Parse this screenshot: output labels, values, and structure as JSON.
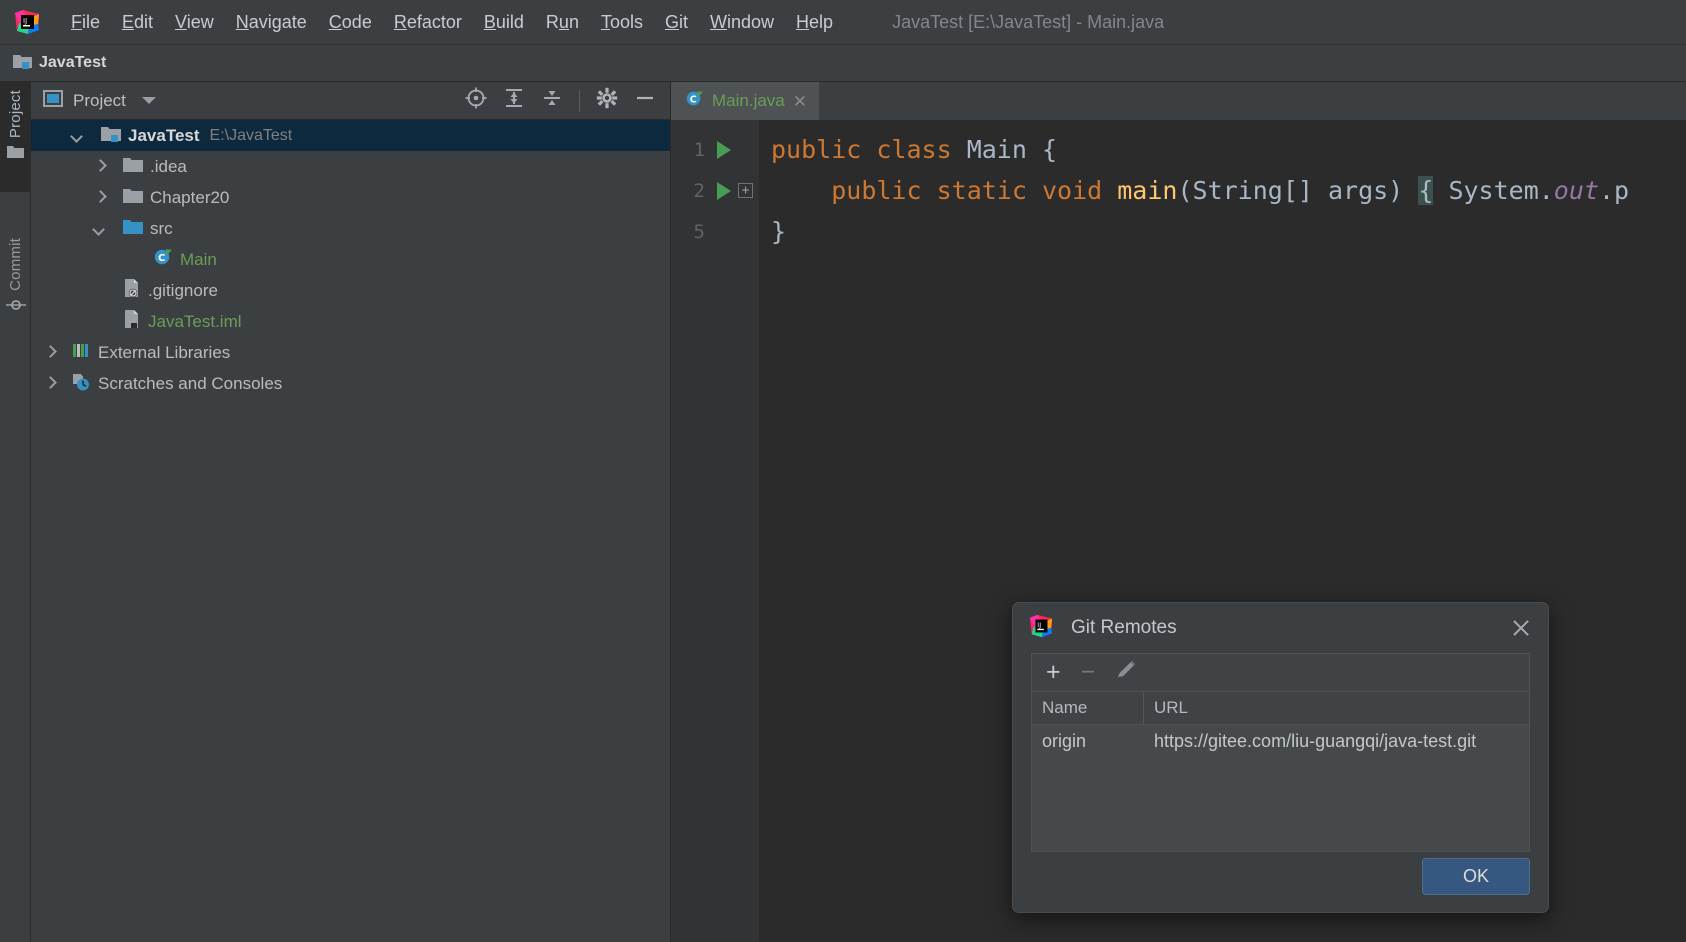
{
  "app": {
    "window_title": "JavaTest [E:\\JavaTest] - Main.java",
    "logo_icon": "intellij-idea-logo"
  },
  "menubar": {
    "items": [
      {
        "label": "File",
        "mnemonic": "F"
      },
      {
        "label": "Edit",
        "mnemonic": "E"
      },
      {
        "label": "View",
        "mnemonic": "V"
      },
      {
        "label": "Navigate",
        "mnemonic": "N"
      },
      {
        "label": "Code",
        "mnemonic": "C"
      },
      {
        "label": "Refactor",
        "mnemonic": "R"
      },
      {
        "label": "Build",
        "mnemonic": "B"
      },
      {
        "label": "Run",
        "mnemonic": "u"
      },
      {
        "label": "Tools",
        "mnemonic": "T"
      },
      {
        "label": "Git",
        "mnemonic": "G"
      },
      {
        "label": "Window",
        "mnemonic": "W"
      },
      {
        "label": "Help",
        "mnemonic": "H"
      }
    ]
  },
  "navbar": {
    "crumb_label": "JavaTest",
    "crumb_icon": "project-folder-icon"
  },
  "tool_stripe": {
    "project_label": "Project",
    "project_icon": "folder-icon",
    "commit_label": "Commit",
    "commit_icon": "commit-icon"
  },
  "project_panel": {
    "title": "Project",
    "title_icon": "project-view-icon",
    "dropdown_icon": "chevron-down-icon",
    "actions": [
      {
        "name": "select-opened-file-icon",
        "label": "Select Opened File"
      },
      {
        "name": "expand-all-icon",
        "label": "Expand All"
      },
      {
        "name": "collapse-all-icon",
        "label": "Collapse All"
      },
      {
        "name": "gear-icon",
        "label": "Options"
      },
      {
        "name": "hide-icon",
        "label": "Hide"
      }
    ],
    "tree": [
      {
        "label": "JavaTest",
        "sub": "E:\\JavaTest",
        "icon": "project-folder-icon",
        "arrow": "down",
        "indent": 0,
        "selected": true,
        "bold": true,
        "color": "default"
      },
      {
        "label": ".idea",
        "sub": "",
        "icon": "folder-icon",
        "arrow": "right",
        "indent": 1,
        "selected": false,
        "bold": false,
        "color": "default"
      },
      {
        "label": "Chapter20",
        "sub": "",
        "icon": "folder-icon",
        "arrow": "right",
        "indent": 1,
        "selected": false,
        "bold": false,
        "color": "default"
      },
      {
        "label": "src",
        "sub": "",
        "icon": "source-folder-icon",
        "arrow": "down",
        "indent": 1,
        "selected": false,
        "bold": false,
        "color": "default"
      },
      {
        "label": "Main",
        "sub": "",
        "icon": "java-class-icon",
        "arrow": "blank",
        "indent": 3,
        "selected": false,
        "bold": false,
        "color": "green"
      },
      {
        "label": ".gitignore",
        "sub": "",
        "icon": "gitignore-file-icon",
        "arrow": "blank",
        "indent": 2,
        "selected": false,
        "bold": false,
        "color": "default"
      },
      {
        "label": "JavaTest.iml",
        "sub": "",
        "icon": "iml-file-icon",
        "arrow": "blank",
        "indent": 2,
        "selected": false,
        "bold": false,
        "color": "green"
      },
      {
        "label": "External Libraries",
        "sub": "",
        "icon": "external-libraries-icon",
        "arrow": "right",
        "indent": 0,
        "selected": false,
        "bold": false,
        "color": "default"
      },
      {
        "label": "Scratches and Consoles",
        "sub": "",
        "icon": "scratches-icon",
        "arrow": "right",
        "indent": 0,
        "selected": false,
        "bold": false,
        "color": "default"
      }
    ]
  },
  "editor": {
    "tab_label": "Main.java",
    "tab_icon": "java-class-icon",
    "tab_close_icon": "close-icon",
    "line_numbers": [
      "1",
      "2",
      "5"
    ],
    "run_gutter_icon": "run-triangle-icon",
    "fold_icon": "fold-expand-icon",
    "code_lines": [
      "public class Main {",
      "    public static void main(String[] args) { System.out.p",
      "}"
    ],
    "code_tokens": {
      "l1_kw_public": "public",
      "l1_kw_class": "class",
      "l1_name": "Main",
      "l1_brace": "{",
      "l2_kw_public": "public",
      "l2_kw_static": "static",
      "l2_kw_void": "void",
      "l2_method": "main",
      "l2_params": "(String[] args)",
      "l2_brace": "{",
      "l2_system": "System.",
      "l2_out": "out",
      "l2_tail": ".p",
      "l3_brace": "}"
    }
  },
  "dialog": {
    "title": "Git Remotes",
    "title_icon": "intellij-idea-logo",
    "close_icon": "close-icon",
    "toolbar": {
      "add_label": "+",
      "remove_label": "−",
      "edit_icon": "pencil-icon"
    },
    "columns": [
      "Name",
      "URL"
    ],
    "rows": [
      {
        "name": "origin",
        "url": "https://gitee.com/liu-guangqi/java-test.git"
      }
    ],
    "ok_label": "OK"
  },
  "colors": {
    "accent_blue": "#365880",
    "selection_blue": "#0d293e",
    "panel_bg": "#3c3f41",
    "editor_bg": "#2b2b2b",
    "green_text": "#6a9e55",
    "keyword_orange": "#cc7832",
    "method_yellow": "#ffc66d",
    "field_purple": "#9876aa"
  }
}
